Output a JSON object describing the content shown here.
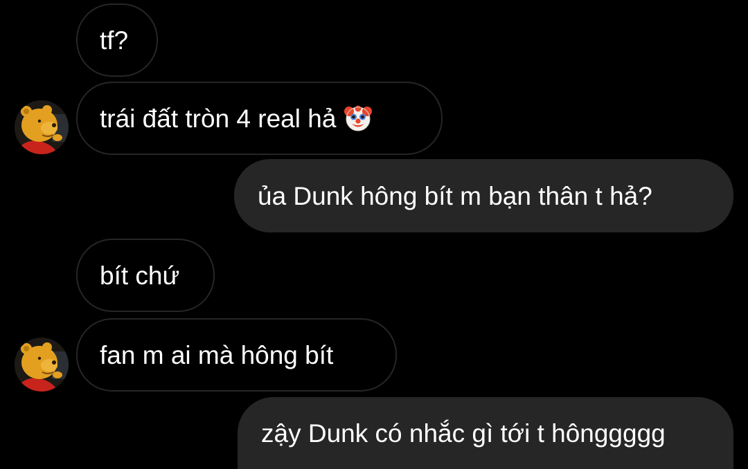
{
  "messages": [
    {
      "sender": "them",
      "text": "tf?"
    },
    {
      "sender": "them",
      "text": "trái đất tròn 4 real hả",
      "emoji": "clown-face-emoji"
    },
    {
      "sender": "me",
      "text": "ủa Dunk hông bít m bạn thân t hả?"
    },
    {
      "sender": "them",
      "text": "bít chứ"
    },
    {
      "sender": "them",
      "text": "fan m ai mà hông bít"
    },
    {
      "sender": "me",
      "text": "zậy Dunk có nhắc gì tới t hônggggg"
    }
  ],
  "avatar": {
    "icon": "winnie-the-pooh-avatar"
  },
  "colors": {
    "background": "#000000",
    "outgoing_bubble": "#262626",
    "incoming_border": "#262626",
    "text": "#ffffff"
  }
}
